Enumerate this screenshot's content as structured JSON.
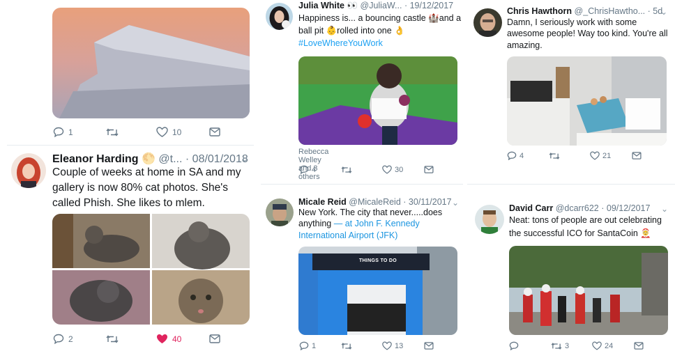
{
  "tweets": {
    "plane": {
      "replies": "1",
      "retweets": "",
      "likes": "10"
    },
    "eleanor": {
      "name": "Eleanor Harding",
      "emoji": "🌕",
      "handle": "@t...",
      "date": "· 08/01/2018",
      "text": "Couple of weeks at home in SA and my gallery is now 80% cat photos. She's called Phish. She likes to mlem.",
      "replies": "2",
      "retweets": "",
      "likes": "40"
    },
    "julia": {
      "name": "Julia White 👀",
      "handle": "@JuliaW...",
      "date": "· 19/12/2017",
      "text_part1": "Happiness is... a bouncing castle 🏰and a ball pit 👶rolled into one 👌",
      "hashtag": "#LoveWhereYouWork",
      "caption": "Rebecca Welley and 3 others",
      "replies": "4",
      "retweets": "",
      "likes": "30"
    },
    "chris": {
      "name": "Chris Hawthorn",
      "handle": "@_ChrisHawtho...",
      "date": "· 5d",
      "text": "Damn, I seriously work with some awesome people! Way too kind. You're all amazing.",
      "replies": "4",
      "retweets": "",
      "likes": "21"
    },
    "micale": {
      "name": "Micale Reid",
      "handle": "@MicaleReid",
      "date": "· 30/11/2017",
      "text_part1": "New York. The city that never.....does anything",
      "location": "— at John F. Kennedy International Airport (JFK)",
      "media_sign": "THINGS TO DO",
      "replies": "1",
      "retweets": "",
      "likes": "13"
    },
    "david": {
      "name": "David Carr",
      "handle": "@dcarr622",
      "date": "· 09/12/2017",
      "text": "Neat: tons of people are out celebrating the successful ICO for SantaCoin 🤶",
      "replies": "",
      "retweets": "3",
      "likes": "24"
    }
  },
  "colors": {
    "action_grey": "#657786",
    "liked_red": "#e0245e",
    "link_blue": "#1da1f2"
  },
  "icons": [
    "reply-icon",
    "retweet-icon",
    "like-icon",
    "dm-icon",
    "chevron-down-icon"
  ]
}
